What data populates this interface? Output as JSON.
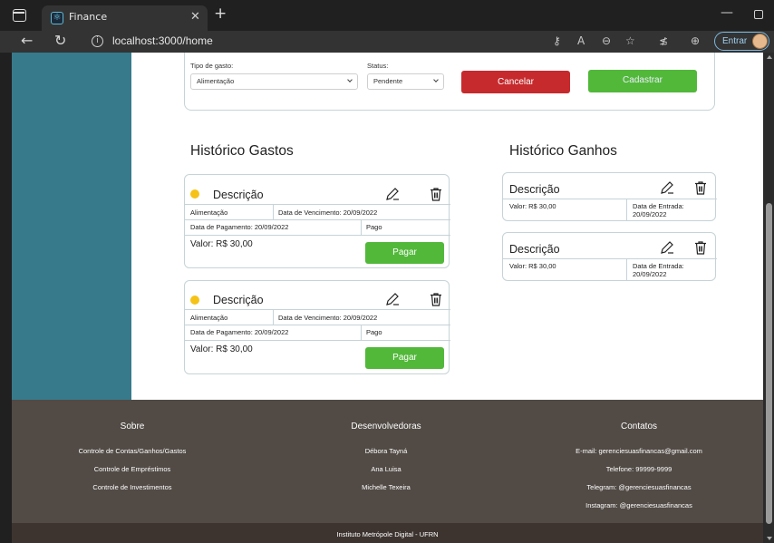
{
  "browser": {
    "tab_title": "Finance",
    "url": "localhost:3000/home",
    "signin_label": "Entrar"
  },
  "form": {
    "tipo_label": "Tipo de gasto:",
    "tipo_value": "Alimentação",
    "status_label": "Status:",
    "status_value": "Pendente",
    "cancel_label": "Cancelar",
    "submit_label": "Cadastrar"
  },
  "expenses": {
    "title": "Histórico Gastos",
    "cards": [
      {
        "status_color": "#f5c318",
        "title": "Descrição",
        "category": "Alimentação",
        "due_date": "Data de Vencimento: 20/09/2022",
        "payment_date": "Data de Pagamento: 20/09/2022",
        "status": "Pago",
        "value": "Valor: R$ 30,00",
        "pay_label": "Pagar"
      },
      {
        "status_color": "#f5c318",
        "title": "Descrição",
        "category": "Alimentação",
        "due_date": "Data de Vencimento: 20/09/2022",
        "payment_date": "Data de Pagamento: 20/09/2022",
        "status": "Pago",
        "value": "Valor: R$ 30,00",
        "pay_label": "Pagar"
      }
    ]
  },
  "incomes": {
    "title": "Histórico Ganhos",
    "cards": [
      {
        "title": "Descrição",
        "value": "Valor: R$ 30,00",
        "entry_label": "Data de Entrada:",
        "entry_date": "20/09/2022"
      },
      {
        "title": "Descrição",
        "value": "Valor: R$ 30,00",
        "entry_label": "Data de Entrada:",
        "entry_date": "20/09/2022"
      }
    ]
  },
  "footer": {
    "sobre": {
      "title": "Sobre",
      "items": [
        "Controle de Contas/Ganhos/Gastos",
        "Controle de Empréstimos",
        "Controle de Investimentos"
      ]
    },
    "devs": {
      "title": "Desenvolvedoras",
      "items": [
        "Débora Tayná",
        "Ana Luisa",
        "Michelle Texeira"
      ]
    },
    "contatos": {
      "title": "Contatos",
      "items": [
        "E-mail: gerenciesuasfinancas@gmail.com",
        "Telefone: 99999-9999",
        "Telegram: @gerenciesuasfinancas",
        "Instagram: @gerenciesuasfinancas"
      ]
    },
    "bottom": "Instituto Metrópole Digital - UFRN"
  },
  "colors": {
    "sidebar": "#377a8b",
    "cancel": "#c62a2d",
    "success": "#52b83a",
    "pending_dot": "#f5c318",
    "footer": "#514a45"
  }
}
